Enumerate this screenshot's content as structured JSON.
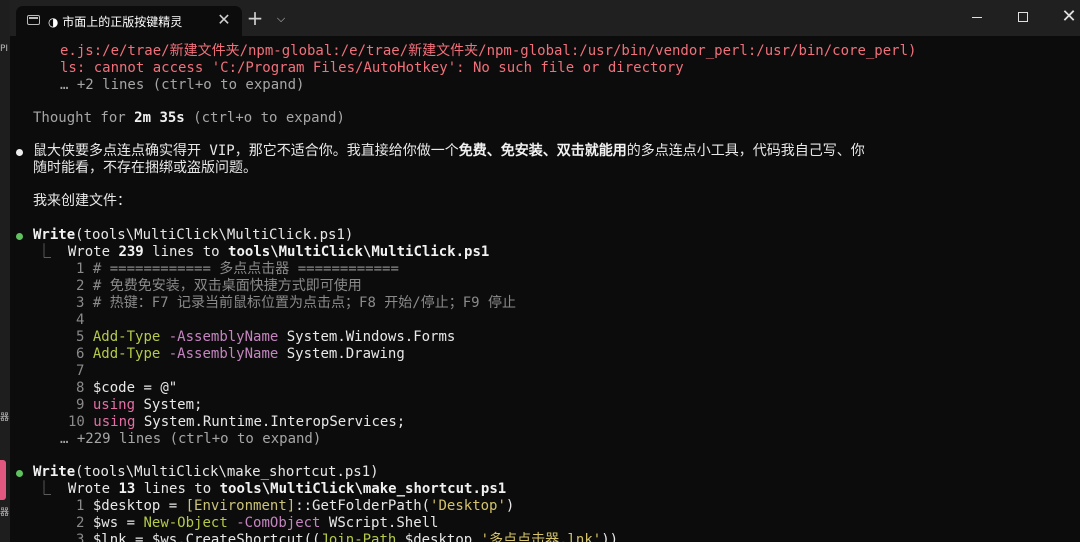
{
  "window": {
    "tab_title": "◑ 市面上的正版按键精灵",
    "tab_close": "✕",
    "new_tab": "+",
    "dropdown": "⌵",
    "close": "✕"
  },
  "side_strip": {
    "top_text": "PI",
    "mid_text": "器",
    "bottom_text": "器"
  },
  "terminal": {
    "path_line": "e.js:/e/trae/新建文件夹/npm-global:/e/trae/新建文件夹/npm-global:/usr/bin/vendor_perl:/usr/bin/core_perl)",
    "ls_error": "ls: cannot access 'C:/Program Files/AutoHotkey': No such file or directory",
    "more_lines_1": "… +2 lines (ctrl+o to expand)",
    "thought_prefix": "Thought for ",
    "thought_time": "2m 35s",
    "thought_suffix": " (ctrl+o to expand)",
    "msg_1a": "鼠大侠要多点连点确实得开 VIP，那它不适合你。我直接给你做一个",
    "msg_1b": "免费、免安装、双击就能用",
    "msg_1c": "的多点连点小工具，代码我自己写、你",
    "msg_2": "随时能看，不存在捆绑或盗版问题。",
    "msg_3": "我来创建文件：",
    "write1_name": "Write",
    "write1_args": "(tools\\MultiClick\\MultiClick.ps1)",
    "write1_result_prefix": "Wrote ",
    "write1_count": "239",
    "write1_mid": " lines to ",
    "write1_path": "tools\\MultiClick\\MultiClick.ps1",
    "code1": [
      {
        "n": "1",
        "t": "# ============ 多点点击器 ============"
      },
      {
        "n": "2",
        "t": "# 免费免安装，双击桌面快捷方式即可使用"
      },
      {
        "n": "3",
        "t": "# 热键：F7 记录当前鼠标位置为点击点；F8 开始/停止；F9 停止"
      },
      {
        "n": "4",
        "t": ""
      },
      {
        "n": "5",
        "a": "Add-Type",
        "b": " -AssemblyName",
        "c": " System.Windows.Forms"
      },
      {
        "n": "6",
        "a": "Add-Type",
        "b": " -AssemblyName",
        "c": " System.Drawing"
      },
      {
        "n": "7",
        "t": ""
      },
      {
        "n": "8",
        "a": "$code",
        "b": " = ",
        "c": "@\""
      },
      {
        "n": "9",
        "a": "using",
        "c": " System;"
      },
      {
        "n": "10",
        "a": "using",
        "c": " System.Runtime.InteropServices;"
      }
    ],
    "more_lines_2": "… +229 lines (ctrl+o to expand)",
    "write2_name": "Write",
    "write2_args": "(tools\\MultiClick\\make_shortcut.ps1)",
    "write2_result_prefix": "Wrote ",
    "write2_count": "13",
    "write2_mid": " lines to ",
    "write2_path": "tools\\MultiClick\\make_shortcut.ps1",
    "code2_1": {
      "n": "1",
      "a": "$desktop",
      "b": " = ",
      "c": "[Environment]",
      "d": "::GetFolderPath(",
      "e": "'Desktop'",
      "f": ")"
    },
    "code2_2": {
      "n": "2",
      "a": "$ws",
      "b": " = ",
      "c": "New-Object",
      "d": " -ComObject",
      "e": " WScript.Shell"
    },
    "code2_3": {
      "n": "3",
      "a": "$lnk",
      "b": " = ",
      "c": "$ws",
      "d": ".CreateShortcut((",
      "e": "Join-Path",
      "f": " $desktop ",
      "g": "'多点点击器.lnk'",
      "h": "))"
    }
  },
  "colors": {
    "background": "#0c0c0c",
    "error": "#f1707b",
    "bullet_ok": "#5fc25f",
    "keyword": "#b6c94a",
    "param": "#c585c0"
  }
}
